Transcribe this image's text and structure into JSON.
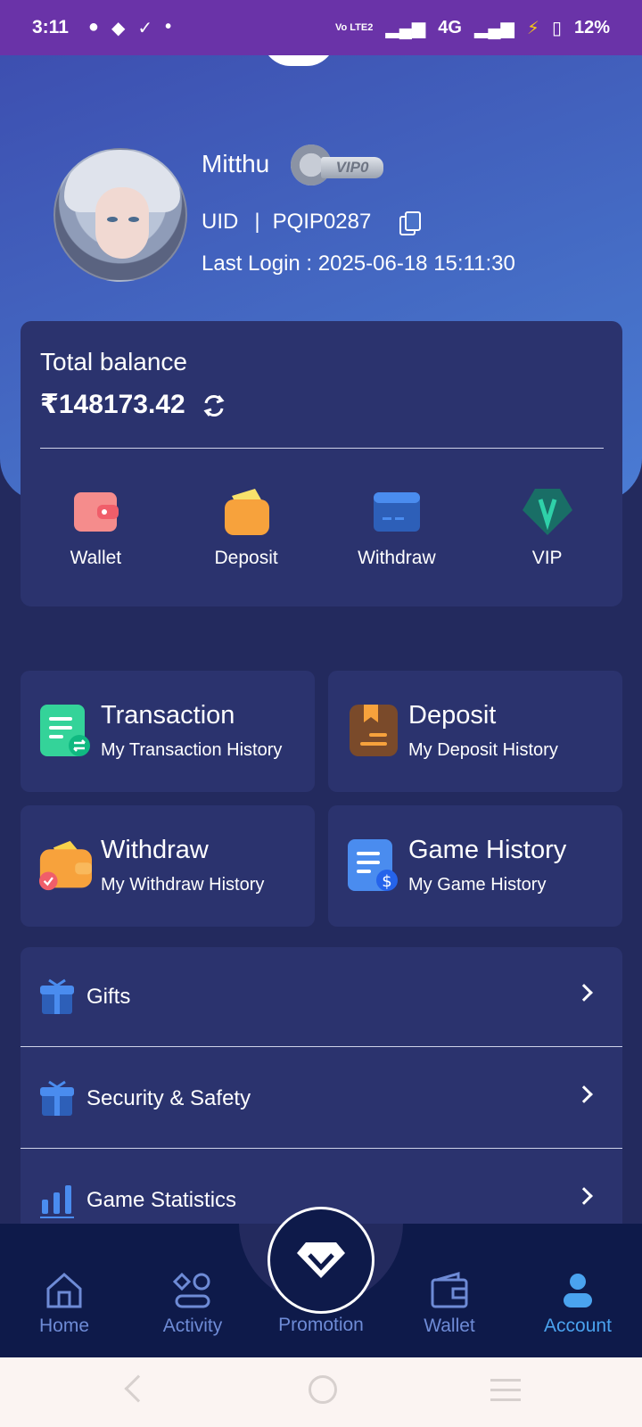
{
  "status_bar": {
    "time": "3:11",
    "network_small": "Vo LTE2",
    "network": "4G",
    "battery": "12%"
  },
  "profile": {
    "username": "Mitthu",
    "vip_badge": "VIP0",
    "uid_label": "UID",
    "uid_separator": "|",
    "uid_value": "PQIP0287",
    "last_login": "Last Login : 2025-06-18 15:11:30"
  },
  "balance": {
    "label": "Total balance",
    "amount": "₹148173.42",
    "quick_actions": [
      {
        "label": "Wallet",
        "icon": "wallet-icon",
        "color": "#f58c8c"
      },
      {
        "label": "Deposit",
        "icon": "deposit-icon",
        "color": "#f7a23c"
      },
      {
        "label": "Withdraw",
        "icon": "withdraw-card-icon",
        "color": "#4a8cef"
      },
      {
        "label": "VIP",
        "icon": "vip-icon",
        "color": "#1fa38a"
      }
    ]
  },
  "tiles": [
    {
      "title": "Transaction",
      "subtitle": "My Transaction History",
      "icon": "transaction-icon",
      "color": "#34d399"
    },
    {
      "title": "Deposit",
      "subtitle": "My Deposit History",
      "icon": "deposit-history-icon",
      "color": "#a0622d"
    },
    {
      "title": "Withdraw",
      "subtitle": "My Withdraw History",
      "icon": "withdraw-history-icon",
      "color": "#f7a23c"
    },
    {
      "title": "Game History",
      "subtitle": "My Game History",
      "icon": "game-history-icon",
      "color": "#4a8cef"
    }
  ],
  "menu": [
    {
      "label": "Gifts",
      "icon": "gift-icon"
    },
    {
      "label": "Security & Safety",
      "icon": "gift-icon"
    },
    {
      "label": "Game Statistics",
      "icon": "bar-chart-icon"
    }
  ],
  "bottom_nav": {
    "items": [
      {
        "label": "Home",
        "icon": "home-icon"
      },
      {
        "label": "Activity",
        "icon": "activity-icon"
      },
      {
        "label": "Promotion",
        "icon": "diamond-icon"
      },
      {
        "label": "Wallet",
        "icon": "wallet-nav-icon"
      },
      {
        "label": "Account",
        "icon": "account-icon"
      }
    ],
    "active": "Account"
  }
}
